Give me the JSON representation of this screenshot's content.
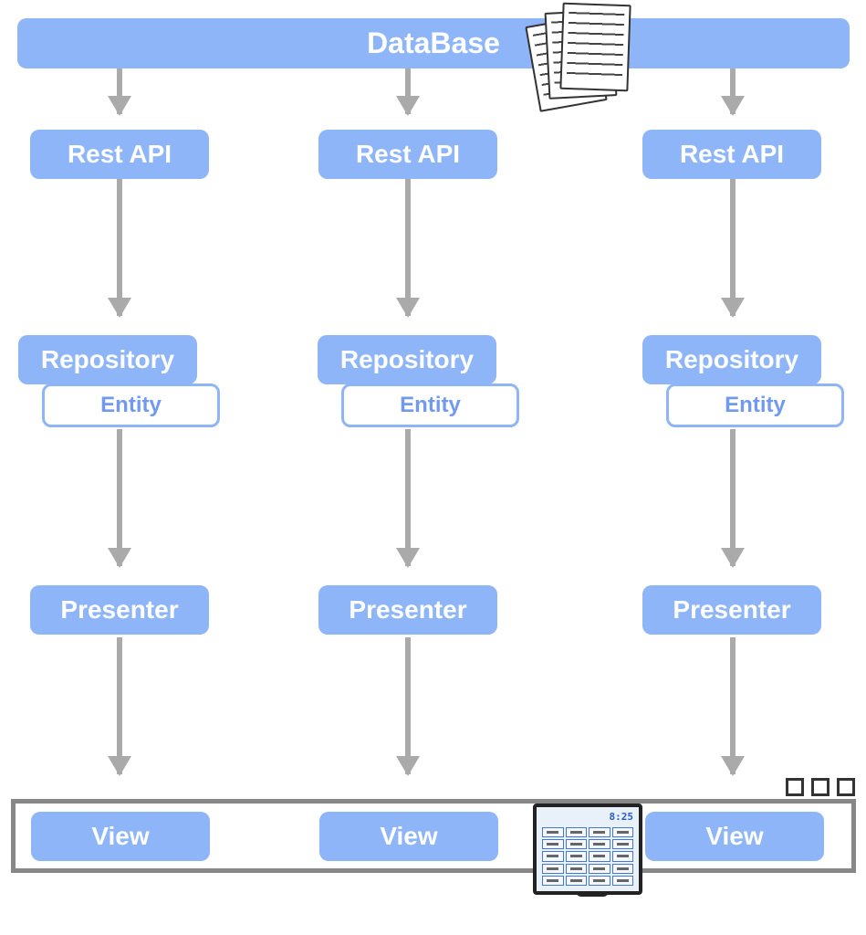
{
  "database": {
    "label": "DataBase"
  },
  "columns": [
    {
      "restapi": "Rest API",
      "repository": "Repository",
      "entity": "Entity",
      "presenter": "Presenter",
      "view": "View"
    },
    {
      "restapi": "Rest API",
      "repository": "Repository",
      "entity": "Entity",
      "presenter": "Presenter",
      "view": "View"
    },
    {
      "restapi": "Rest API",
      "repository": "Repository",
      "entity": "Entity",
      "presenter": "Presenter",
      "view": "View"
    }
  ],
  "monitor": {
    "time": "8:25"
  },
  "colors": {
    "box": "#8eb5f7",
    "entityBorder": "#8eb5f7",
    "entityText": "#7199f0",
    "arrow": "#aaaaaa"
  }
}
